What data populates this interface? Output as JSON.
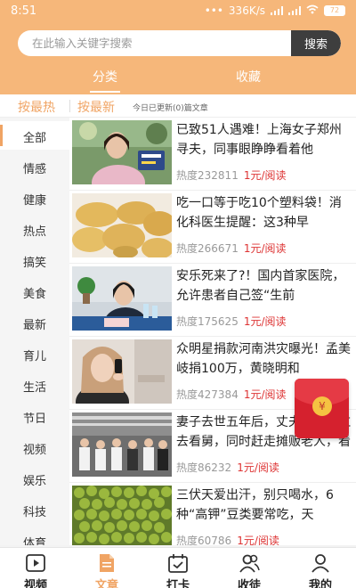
{
  "status_bar": {
    "time": "8:51",
    "speed": "336K/s",
    "battery": "72"
  },
  "search": {
    "placeholder": "在此输入关键字搜索",
    "button": "搜索"
  },
  "top_tabs": [
    {
      "label": "分类",
      "active": true
    },
    {
      "label": "收藏",
      "active": false
    }
  ],
  "sort": {
    "hot": "按最热",
    "new": "按最新",
    "note": "今日已更新(0)篇文章"
  },
  "categories": [
    "全部",
    "情感",
    "健康",
    "热点",
    "搞笑",
    "美食",
    "最新",
    "育儿",
    "生活",
    "节日",
    "视频",
    "娱乐",
    "科技",
    "体育"
  ],
  "articles": [
    {
      "title": "已致51人遇难！上海女子郑州寻夫，同事眼睁睁看着他",
      "heat_label": "热度",
      "heat": "232811",
      "pay": "1元/阅读"
    },
    {
      "title": "吃一口等于吃10个塑料袋！消化科医生提醒：这3种早",
      "heat_label": "热度",
      "heat": "266671",
      "pay": "1元/阅读"
    },
    {
      "title": "安乐死来了?！国内首家医院，允许患者自己签“生前",
      "heat_label": "热度",
      "heat": "175625",
      "pay": "1元/阅读"
    },
    {
      "title": "众明星捐款河南洪灾曝光！孟美岐捐100万，黄晓明和",
      "heat_label": "热度",
      "heat": "427384",
      "pay": "1元/阅读"
    },
    {
      "title": "妻子去世五年后，丈夫被儿子拉去看舅，同时赶走摊贩老人，看见老人",
      "heat_label": "热度",
      "heat": "86232",
      "pay": "1元/阅读"
    },
    {
      "title": "三伏天爱出汗，别只喝水，6种“高钾”豆类要常吃，天",
      "heat_label": "热度",
      "heat": "60786",
      "pay": "1元/阅读"
    }
  ],
  "red_packet": {
    "symbol": "¥"
  },
  "bottom_nav": [
    {
      "label": "视频",
      "icon": "video-icon",
      "active": false
    },
    {
      "label": "文章",
      "icon": "article-icon",
      "active": true
    },
    {
      "label": "打卡",
      "icon": "calendar-check-icon",
      "active": false
    },
    {
      "label": "收徒",
      "icon": "users-icon",
      "active": false
    },
    {
      "label": "我的",
      "icon": "user-icon",
      "active": false
    }
  ],
  "colors": {
    "header": "#f6b77a",
    "accent": "#f0a464",
    "pay": "#dd3333",
    "red_packet": "#d5212e"
  }
}
